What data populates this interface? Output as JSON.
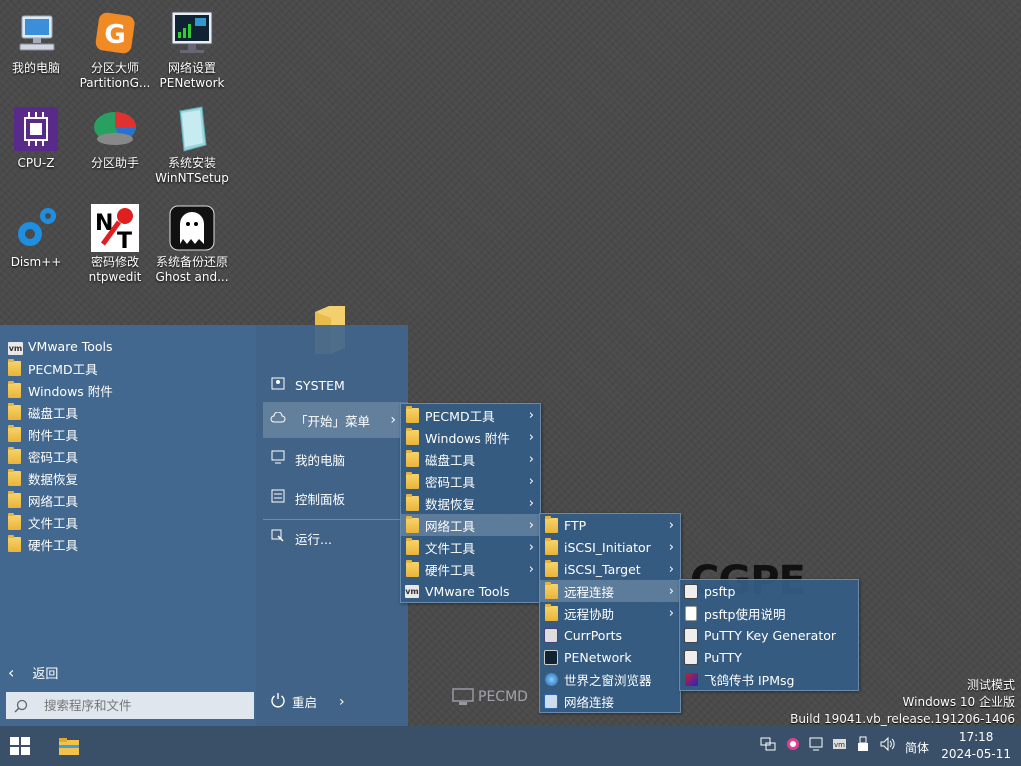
{
  "desktop_icons": [
    {
      "label1": "我的电脑",
      "label2": ""
    },
    {
      "label1": "分区大师",
      "label2": "PartitionG..."
    },
    {
      "label1": "网络设置",
      "label2": "PENetwork"
    },
    {
      "label1": "CPU-Z",
      "label2": ""
    },
    {
      "label1": "分区助手",
      "label2": ""
    },
    {
      "label1": "系统安装",
      "label2": "WinNTSetup"
    },
    {
      "label1": "Dism++",
      "label2": ""
    },
    {
      "label1": "密码修改",
      "label2": "ntpwedit"
    },
    {
      "label1": "系统备份还原",
      "label2": "Ghost and..."
    }
  ],
  "watermark": {
    "cgpe": "CGPE",
    "pecmd": "PECMD"
  },
  "start_menu": {
    "list": [
      "VMware Tools",
      "PECMD工具",
      "Windows 附件",
      "磁盘工具",
      "附件工具",
      "密码工具",
      "数据恢复",
      "网络工具",
      "文件工具",
      "硬件工具"
    ],
    "back_label": "返回",
    "search_placeholder": "搜索程序和文件",
    "right": {
      "system": "SYSTEM",
      "start_menu": "「开始」菜单",
      "my_computer": "我的电脑",
      "control_panel": "控制面板",
      "run": "运行...",
      "restart": "重启"
    }
  },
  "submenu1": [
    "PECMD工具",
    "Windows 附件",
    "磁盘工具",
    "密码工具",
    "数据恢复",
    "网络工具",
    "文件工具",
    "硬件工具",
    "VMware Tools"
  ],
  "submenu2": [
    "FTP",
    "iSCSI_Initiator",
    "iSCSI_Target",
    "远程连接",
    "远程协助",
    "CurrPorts",
    "PENetwork",
    "世界之窗浏览器",
    "网络连接"
  ],
  "submenu3": [
    "psftp",
    "psftp使用说明",
    "PuTTY Key Generator",
    "PuTTY",
    "飞鸽传书 IPMsg"
  ],
  "sysinfo": {
    "line1": "测试模式",
    "line2": "Windows 10 企业版",
    "line3": "Build 19041.vb_release.191206-1406"
  },
  "taskbar": {
    "ime": "简体",
    "time": "17:18",
    "date": "2024-05-11"
  }
}
